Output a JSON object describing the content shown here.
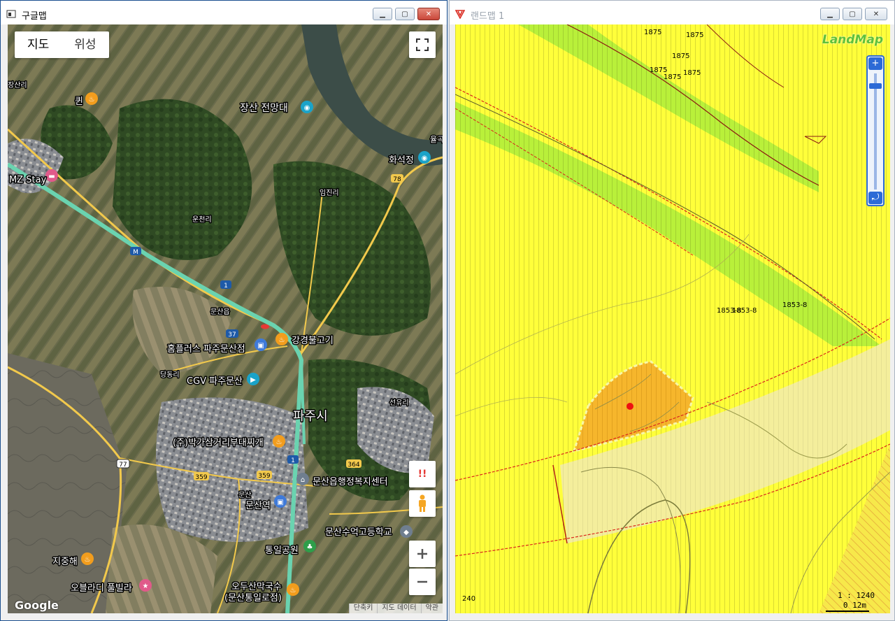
{
  "left_window": {
    "title": "구글맵",
    "map_type_buttons": [
      "지도",
      "위성"
    ],
    "labels": {
      "kwin": "퀸",
      "jangsan": "장산 전망대",
      "hwaseok": "화석정",
      "mzstay": "MZ Stay",
      "homeplus": "홈플러스 파주문산점",
      "gangyeong": "강경불고기",
      "cgv": "CGV 파주문산",
      "pajusi": "파주시",
      "bakga": "(주)박가삼거리부대찌개",
      "munsaneup": "문산읍행정복지센터",
      "munsanyeok": "문산역",
      "munsansueok": "문산수억고등학교",
      "tongil": "통일공원",
      "jijunghae": "지중해",
      "oblady": "오블라디 풀빌라",
      "odusan1": "오두산막국수",
      "odusan2": "(문산통일로점)",
      "jangsanri": "장산리",
      "imjinri": "임진리",
      "unjeonri": "운천리",
      "munsaneup_small": "문산읍",
      "dangdongri": "당동리",
      "seonyuri": "선유리",
      "munsan": "문산",
      "yulgok": "율곡"
    },
    "route_badges": [
      "1",
      "37",
      "78",
      "77",
      "359",
      "359",
      "364",
      "1"
    ],
    "motorway_badge": "M",
    "alert_btn": "!!",
    "google_logo": "Google",
    "attribution": [
      "단축키",
      "지도 데이터",
      "약관"
    ],
    "colors": {
      "route_green": "#6ad3b0",
      "road_yellow": "#f2c94c",
      "marker_red": "#e53935"
    }
  },
  "right_window": {
    "title": "랜드맵 1",
    "brand": "LandMap",
    "parcel_labels": [
      "1875",
      "1875",
      "1875",
      "1875",
      "1875",
      "1875",
      "1853-8",
      "1853-8",
      "1853-8",
      "240"
    ],
    "scale_ratio": "1 : 1240",
    "scale_bar": "0    12m",
    "colors": {
      "zone_yellow": "#ffff3a",
      "zone_green": "#b9f03a",
      "parcel_orange": "#f6b62c",
      "boundary_red": "#d9261c",
      "pale_band": "#f4ee9c"
    }
  }
}
